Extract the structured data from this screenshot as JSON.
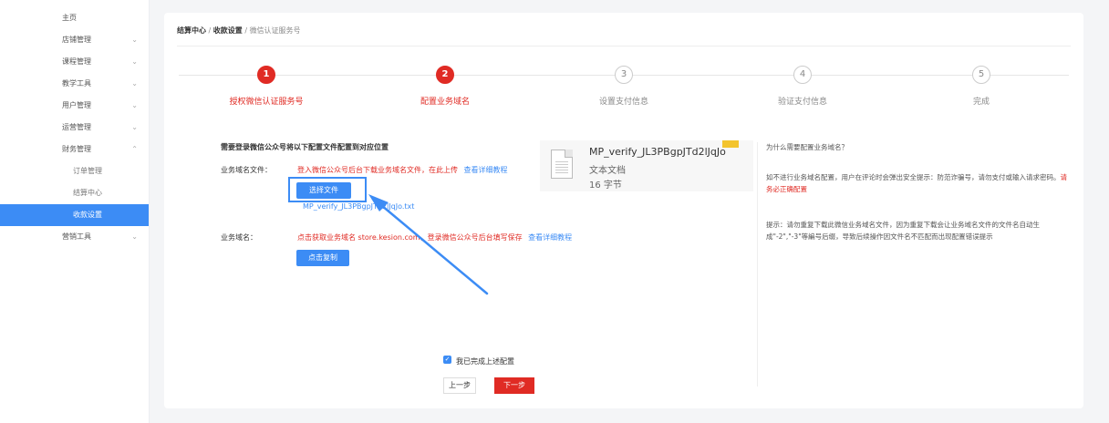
{
  "sidebar": {
    "items": [
      {
        "label": "主页",
        "chev": ""
      },
      {
        "label": "店铺管理",
        "chev": "⌄"
      },
      {
        "label": "课程管理",
        "chev": "⌄"
      },
      {
        "label": "教学工具",
        "chev": "⌄"
      },
      {
        "label": "用户管理",
        "chev": "⌄"
      },
      {
        "label": "运营管理",
        "chev": "⌄"
      },
      {
        "label": "财务管理",
        "chev": "⌃"
      },
      {
        "label": "订单管理",
        "chev": ""
      },
      {
        "label": "结算中心",
        "chev": ""
      },
      {
        "label": "收款设置",
        "chev": ""
      },
      {
        "label": "营销工具",
        "chev": "⌄"
      }
    ]
  },
  "breadcrumb": {
    "part1": "结算中心",
    "sep": " / ",
    "part2": "收款设置",
    "part3": "微信认证服务号"
  },
  "steps": [
    {
      "num": "1",
      "label": "授权微信认证服务号"
    },
    {
      "num": "2",
      "label": "配置业务域名"
    },
    {
      "num": "3",
      "label": "设置支付信息"
    },
    {
      "num": "4",
      "label": "验证支付信息"
    },
    {
      "num": "5",
      "label": "完成"
    }
  ],
  "form": {
    "title": "需要登录微信公众号将以下配置文件配置到对应位置",
    "file_label": "业务域名文件：",
    "file_instruction": "登入微信公众号后台下载业务域名文件，在此上传",
    "file_tutorial": "查看详细教程",
    "choose_file_button": "选择文件",
    "uploaded_file": "MP_verify_JL3PBgpJTd2lJqJo.txt",
    "domain_label": "业务域名：",
    "domain_instruction": "点击获取业务域名 store.kesion.com，登录微信公众号后台填写保存",
    "domain_tutorial": "查看详细教程",
    "copy_button": "点击复制"
  },
  "file_popup": {
    "name": "MP_verify_JL3PBgpJTd2lJqJo",
    "type": "文本文档",
    "size": "16 字节"
  },
  "help": {
    "question": "为什么需要配置业务域名？",
    "para1": "如不进行业务域名配置，用户在评论时会弹出安全提示：防范诈骗号，请勿支付或输入请求密码。",
    "para1_link": "请务必正确配置",
    "para2": "提示：请勿重复下载此微信业务域名文件，因为重复下载会让业务域名文件的文件名自动生成\"-2\",\"-3\"等編号后缀，导致后续操作因文件名不匹配而出现配置错误提示"
  },
  "footer": {
    "check_mark": "✓",
    "checkbox_label": "我已完成上述配置",
    "prev_button": "上一步",
    "next_button": "下一步"
  },
  "colors": {
    "accent_blue": "#3c8cf5",
    "accent_red": "#e02b24"
  }
}
